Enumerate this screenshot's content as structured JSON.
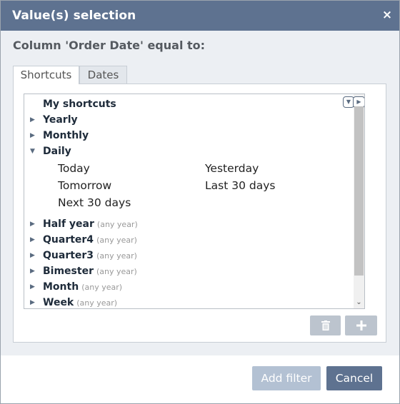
{
  "dialog": {
    "title": "Value(s) selection",
    "close_label": "×"
  },
  "heading": "Column 'Order Date' equal to:",
  "tabs": [
    {
      "label": "Shortcuts",
      "active": true
    },
    {
      "label": "Dates",
      "active": false
    }
  ],
  "tree": {
    "root_label": "My shortcuts",
    "collapsed_top": [
      {
        "label": "Yearly"
      },
      {
        "label": "Monthly"
      }
    ],
    "expanded": {
      "label": "Daily",
      "options": [
        "Today",
        "Yesterday",
        "Tomorrow",
        "Last 30 days",
        "Next 30 days"
      ]
    },
    "period_nodes": [
      {
        "label": "Half year",
        "note": "(any year)"
      },
      {
        "label": "Quarter4",
        "note": "(any year)"
      },
      {
        "label": "Quarter3",
        "note": "(any year)"
      },
      {
        "label": "Bimester",
        "note": "(any year)"
      },
      {
        "label": "Month",
        "note": "(any year)"
      },
      {
        "label": "Week",
        "note": "(any year)"
      }
    ]
  },
  "icons": {
    "collapse_all": "chevron-down-icon",
    "expand_all": "chevron-right-icon",
    "delete": "trash-icon",
    "add": "plus-icon"
  },
  "footer": {
    "add_filter_label": "Add filter",
    "cancel_label": "Cancel"
  },
  "colors": {
    "titlebar": "#5e7290",
    "primary_button": "#5e7290",
    "disabled_button": "#b3c1d3",
    "icon_button": "#bcc4ce"
  }
}
